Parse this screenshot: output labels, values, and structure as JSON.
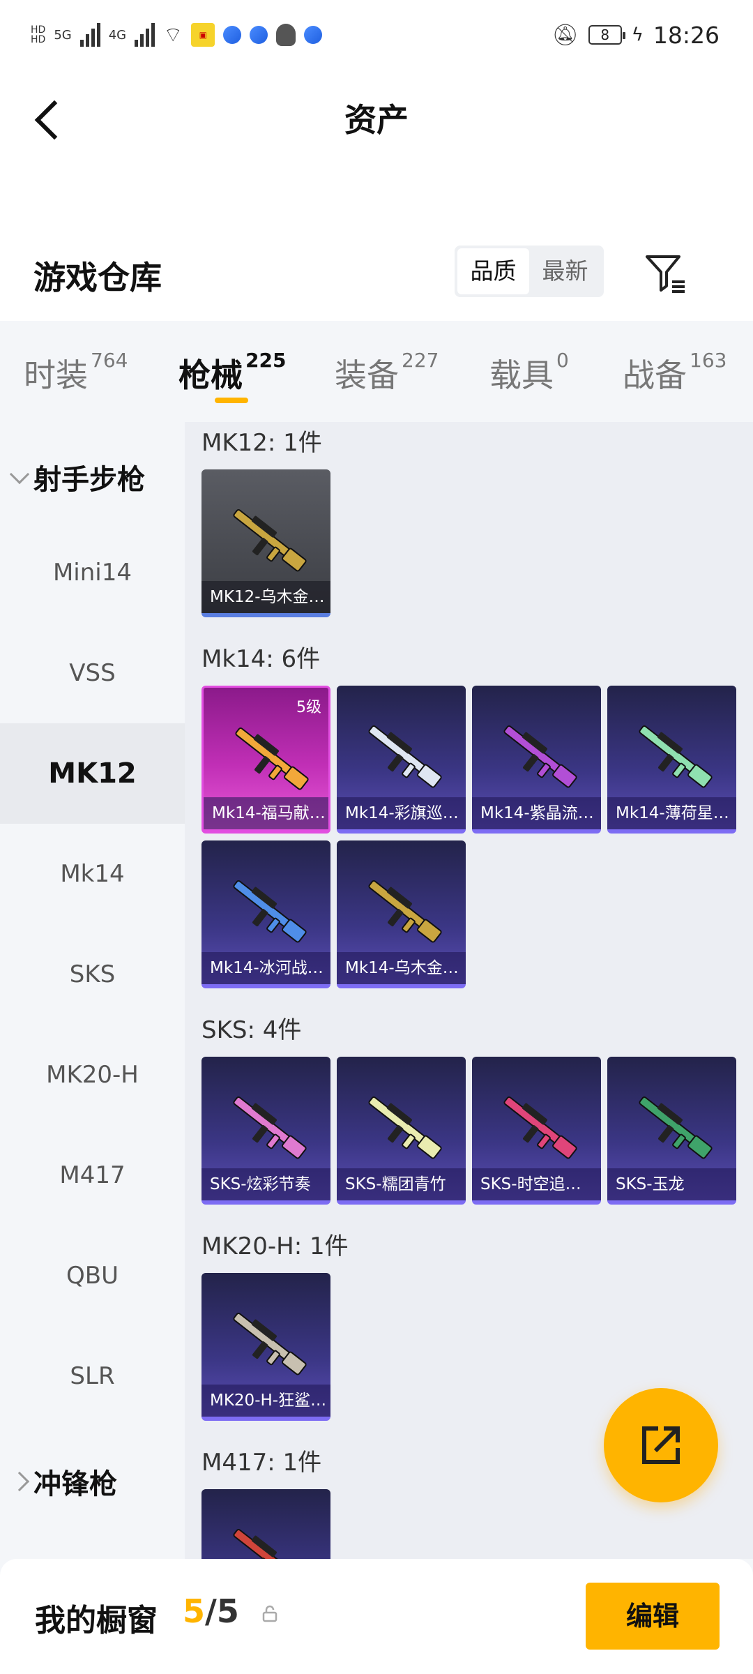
{
  "status_bar": {
    "time": "18:26",
    "battery": "8",
    "network_1": "5G",
    "network_2": "4G"
  },
  "header": {
    "title": "资产"
  },
  "repo": {
    "title": "游戏仓库",
    "sort_options": [
      "品质",
      "最新"
    ],
    "sort_selected": "品质"
  },
  "tabs": [
    {
      "label": "时装",
      "count": "764"
    },
    {
      "label": "枪械",
      "count": "225"
    },
    {
      "label": "装备",
      "count": "227"
    },
    {
      "label": "载具",
      "count": "0"
    },
    {
      "label": "战备",
      "count": "163"
    }
  ],
  "sidebar": {
    "group_open": "射手步枪",
    "items": [
      "Mini14",
      "VSS",
      "MK12",
      "Mk14",
      "SKS",
      "MK20-H",
      "M417",
      "QBU",
      "SLR"
    ],
    "selected": "MK12",
    "group_closed": "冲锋枪"
  },
  "groups": [
    {
      "label": "MK12: 1件",
      "items": [
        {
          "name": "MK12-乌木金…",
          "style": "gray",
          "gun_color": "#c9a640"
        }
      ]
    },
    {
      "label": "Mk14: 6件",
      "items": [
        {
          "name": "Mk14-福马献…",
          "style": "pink",
          "level": "5级",
          "gun_color": "#f2a83a"
        },
        {
          "name": "Mk14-彩旗巡…",
          "style": "purple",
          "gun_color": "#dfe6f2"
        },
        {
          "name": "Mk14-紫晶流…",
          "style": "purple",
          "gun_color": "#b24fd6"
        },
        {
          "name": "Mk14-薄荷星…",
          "style": "purple",
          "gun_color": "#8fe0b0"
        },
        {
          "name": "Mk14-冰河战…",
          "style": "purple",
          "gun_color": "#4f8ee8"
        },
        {
          "name": "Mk14-乌木金…",
          "style": "purple",
          "gun_color": "#c9a640"
        }
      ]
    },
    {
      "label": "SKS: 4件",
      "items": [
        {
          "name": "SKS-炫彩节奏",
          "style": "purple",
          "gun_color": "#e07ad0"
        },
        {
          "name": "SKS-糯团青竹",
          "style": "purple",
          "gun_color": "#e9ecb0"
        },
        {
          "name": "SKS-时空追…",
          "style": "purple",
          "gun_color": "#e0457a"
        },
        {
          "name": "SKS-玉龙",
          "style": "purple",
          "gun_color": "#3fa36a"
        }
      ]
    },
    {
      "label": "MK20-H: 1件",
      "items": [
        {
          "name": "MK20-H-狂鲨…",
          "style": "purple",
          "gun_color": "#c8c0b0"
        }
      ]
    },
    {
      "label": "M417: 1件",
      "items": [
        {
          "name": "",
          "style": "purple",
          "gun_color": "#d0453a"
        }
      ]
    }
  ],
  "bottom": {
    "title": "我的橱窗",
    "current": "5",
    "total": "/5",
    "edit_label": "编辑"
  }
}
